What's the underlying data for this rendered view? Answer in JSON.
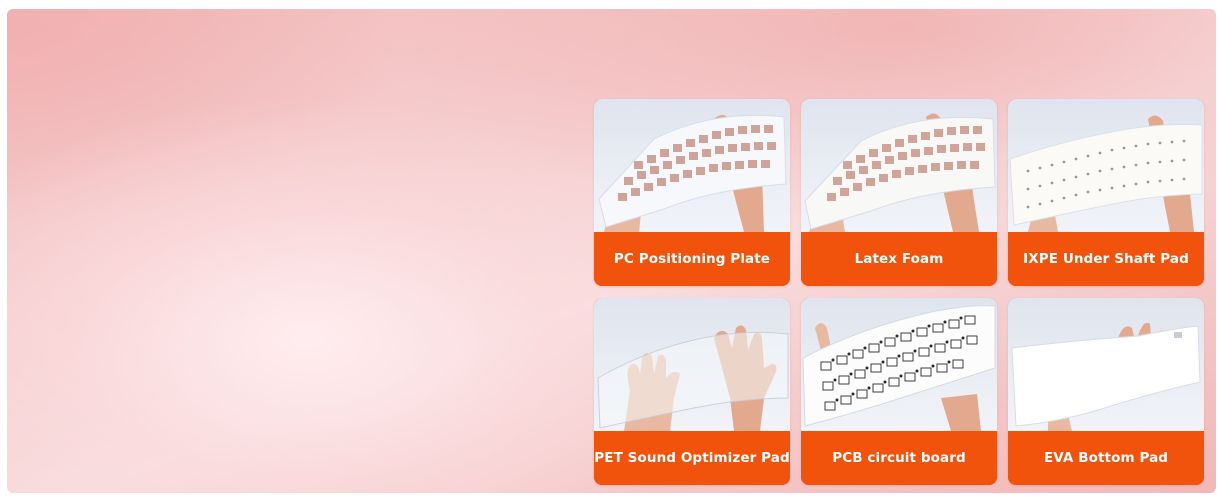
{
  "products": [
    {
      "label": "PC Positioning Plate",
      "icon": "pc-positioning-plate-photo"
    },
    {
      "label": "Latex Foam",
      "icon": "latex-foam-photo"
    },
    {
      "label": "IXPE Under Shaft Pad",
      "icon": "ixpe-under-shaft-pad-photo"
    },
    {
      "label": "PET Sound Optimizer Pad",
      "icon": "pet-sound-optimizer-pad-photo"
    },
    {
      "label": "PCB circuit board",
      "icon": "pcb-circuit-board-photo"
    },
    {
      "label": "EVA Bottom Pad",
      "icon": "eva-bottom-pad-photo"
    }
  ],
  "colors": {
    "label_bg": "#f1530c",
    "label_text": "#ffffff",
    "banner_pink": "#f4c6c6"
  }
}
